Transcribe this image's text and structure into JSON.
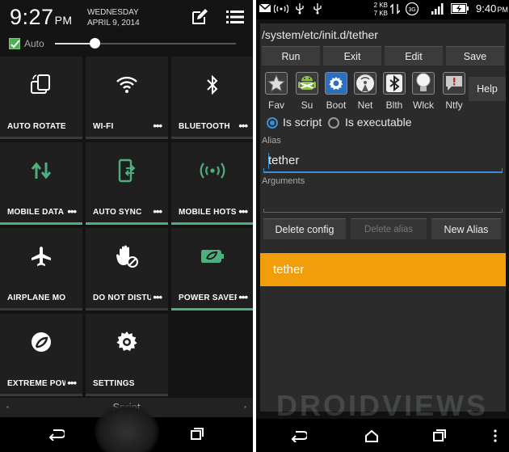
{
  "left": {
    "clock": {
      "time": "9:27",
      "ampm": "PM"
    },
    "date": {
      "weekday": "WEDNESDAY",
      "date": "APRIL 9, 2014"
    },
    "brightness": {
      "auto_label": "Auto",
      "auto_checked": true,
      "level": 0.22
    },
    "tiles": [
      {
        "label": "AUTO ROTATE",
        "icon": "rotate-icon",
        "more": false,
        "active": false
      },
      {
        "label": "WI-FI",
        "icon": "wifi-icon",
        "more": true,
        "active": false
      },
      {
        "label": "BLUETOOTH",
        "icon": "bluetooth-icon",
        "more": true,
        "active": false
      },
      {
        "label": "MOBILE DATA",
        "icon": "mobile-data-icon",
        "more": true,
        "active": true
      },
      {
        "label": "AUTO SYNC",
        "icon": "auto-sync-icon",
        "more": true,
        "active": true
      },
      {
        "label": "MOBILE HOTSPOT",
        "icon": "hotspot-icon",
        "more": true,
        "active": true
      },
      {
        "label": "AIRPLANE MODE",
        "icon": "airplane-icon",
        "more": false,
        "active": false
      },
      {
        "label": "DO NOT DISTURB",
        "icon": "do-not-disturb-icon",
        "more": true,
        "active": false
      },
      {
        "label": "POWER SAVER",
        "icon": "power-saver-icon",
        "more": true,
        "active": true
      },
      {
        "label": "EXTREME POWER SAVING",
        "icon": "extreme-power-icon",
        "more": true,
        "active": false
      },
      {
        "label": "SETTINGS",
        "icon": "settings-icon",
        "more": false,
        "active": false
      }
    ],
    "carrier": "Sprint"
  },
  "right": {
    "status": {
      "net_up": "2 KB",
      "net_down": "7 KB",
      "time": "9:40",
      "ampm": "PM",
      "network": "3G"
    },
    "dialog": {
      "title": "/system/etc/init.d/tether",
      "commands": [
        "Run",
        "Exit",
        "Edit",
        "Save"
      ],
      "quick_items": [
        {
          "label": "Fav",
          "icon": "star-icon"
        },
        {
          "label": "Su",
          "icon": "android-icon"
        },
        {
          "label": "Boot",
          "icon": "boot-gear-icon"
        },
        {
          "label": "Net",
          "icon": "net-icon"
        },
        {
          "label": "Blth",
          "icon": "bluetooth-icon"
        },
        {
          "label": "Wlck",
          "icon": "bulb-icon"
        },
        {
          "label": "Ntfy",
          "icon": "notify-icon"
        }
      ],
      "help": "Help",
      "radio_options": [
        {
          "label": "Is script",
          "selected": true
        },
        {
          "label": "Is executable",
          "selected": false
        }
      ],
      "alias_label": "Alias",
      "alias_value": "tether",
      "arguments_label": "Arguments",
      "arguments_value": "",
      "actions": [
        "Delete config",
        "Delete alias",
        "New Alias"
      ],
      "alias_list": [
        "tether"
      ]
    },
    "watermark": "DROIDVIEWS"
  },
  "colors": {
    "accent_green": "#4caf7d",
    "selection_blue": "#3a8ed8",
    "list_orange": "#f29d0a"
  }
}
